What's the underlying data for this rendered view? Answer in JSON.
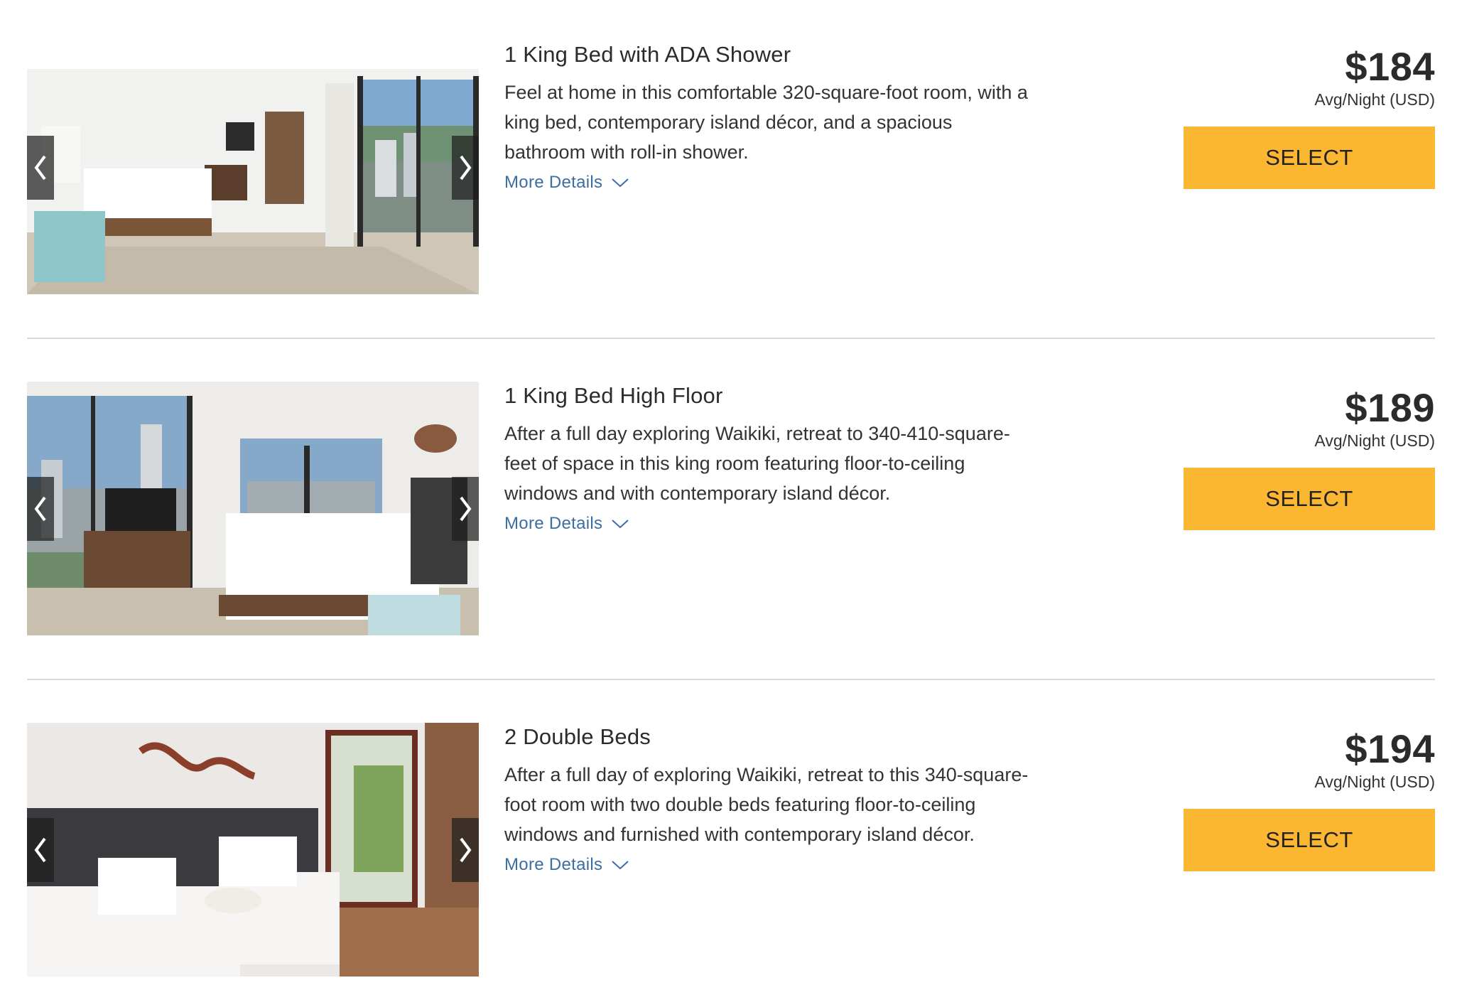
{
  "rooms": [
    {
      "title": "1 King Bed with ADA Shower",
      "description": "Feel at home in this comfortable 320-square-foot room, with a king bed, contemporary island décor, and a spacious bathroom with roll-in shower.",
      "more_details_label": "More Details",
      "price": "$184",
      "price_unit": "Avg/Night (USD)",
      "select_label": "SELECT"
    },
    {
      "title": "1 King Bed High Floor",
      "description": "After a full day exploring Waikiki, retreat to 340-410-square-feet of space in this king room featuring floor-to-ceiling windows and with contemporary island décor.",
      "more_details_label": "More Details",
      "price": "$189",
      "price_unit": "Avg/Night (USD)",
      "select_label": "SELECT"
    },
    {
      "title": "2 Double Beds",
      "description": "After a full day of exploring Waikiki, retreat to this 340-square-foot room with two double beds featuring floor-to-ceiling windows and furnished with contemporary island décor.",
      "more_details_label": "More Details",
      "price": "$194",
      "price_unit": "Avg/Night (USD)",
      "select_label": "SELECT"
    }
  ],
  "icons": {
    "prev": "chevron-left-icon",
    "next": "chevron-right-icon",
    "expand": "chevron-down-icon"
  },
  "colors": {
    "select_button": "#fbb731",
    "link": "#3a6ea5",
    "divider": "#d9d9d9",
    "text": "#2b2b2b"
  }
}
